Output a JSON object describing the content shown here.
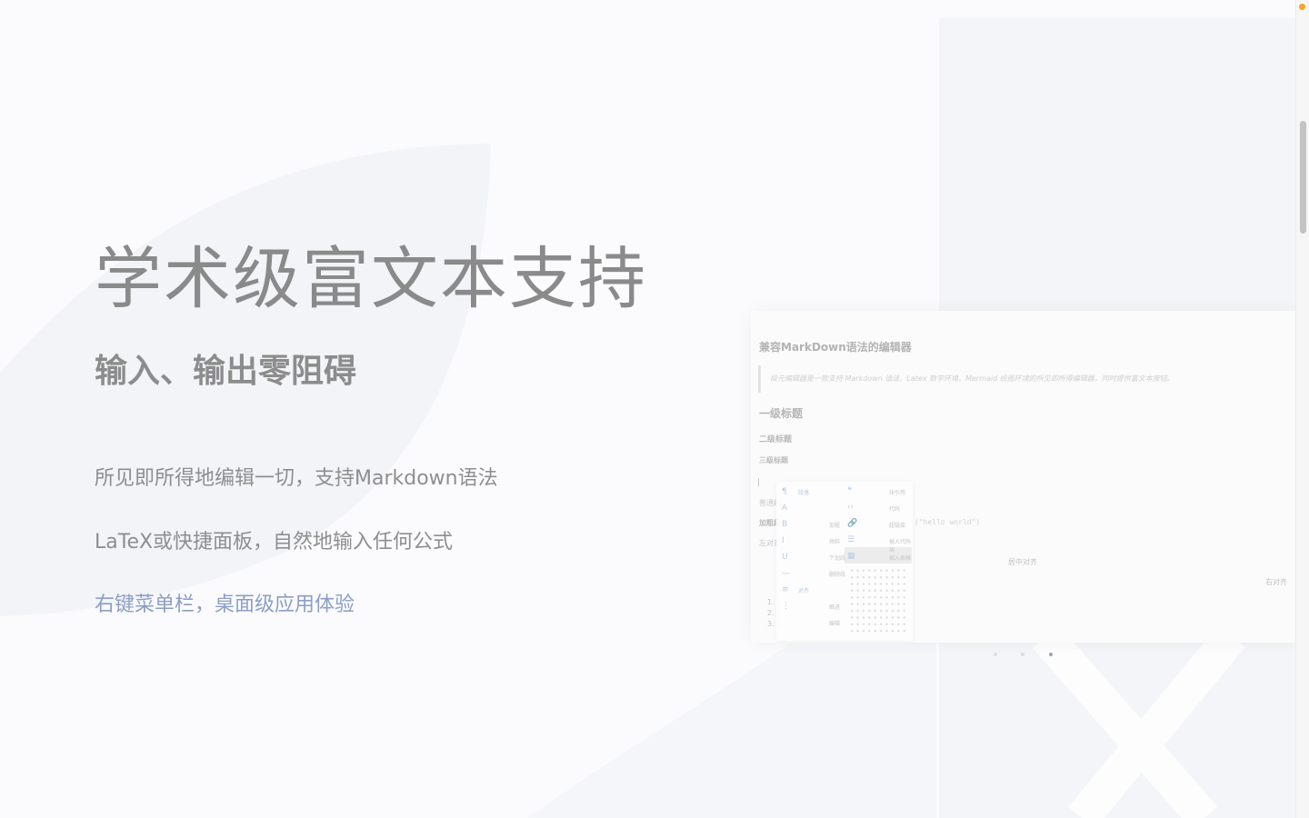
{
  "hero": {
    "title": "学术级富文本支持",
    "subtitle": "输入、输出零阻碍",
    "features": [
      "所见即所得地编辑一切，支持Markdown语法",
      "LaTeX或快捷面板，自然地输入任何公式",
      "右键菜单栏，桌面级应用体验"
    ]
  },
  "preview": {
    "doc_title": "兼容MarkDown语法的编辑器",
    "quote": "段元编辑器是一款支持 Markdown 语法、Latex 数学环境、Mermaid 绘图环境的所见即所得编辑器，同时提供富文本按钮。",
    "h1": "一级标题",
    "h2": "二级标题",
    "h3": "三级标题",
    "line1": "普通段",
    "line2": "加粗段",
    "line3": "左对齐",
    "center_text": "居中对齐",
    "right_text": "右对齐",
    "code_snippet": "(\"hello world\")",
    "list_text": "1. 1\n2. 1\n3. 1",
    "context_menu": {
      "rows": [
        {
          "icon": "¶",
          "left": "段落",
          "right_icon": "❝",
          "right": "块引用"
        },
        {
          "icon": "A",
          "left": "",
          "right_icon": "‹›",
          "right": "代码"
        },
        {
          "icon": "B",
          "left": "加粗",
          "right_icon": "🔗",
          "right": "超链接"
        },
        {
          "icon": "I",
          "left": "倾斜",
          "right_icon": "☰",
          "right": "插入代码块"
        },
        {
          "icon": "U",
          "left": "下划线",
          "right_icon": "▦",
          "right": "插入表格"
        },
        {
          "icon": "—",
          "left": "删除线",
          "right_icon": "",
          "right": ""
        },
        {
          "icon": "≡",
          "left": "对齐",
          "right_icon": "",
          "right": ""
        },
        {
          "icon": "⋮",
          "left": "缩进",
          "right_icon": "",
          "right": ""
        },
        {
          "icon": "",
          "left": "编辑",
          "right_icon": "",
          "right": ""
        }
      ]
    }
  },
  "carousel": {
    "count": 3,
    "active": 2
  },
  "colors": {
    "background": "#fbfbfd",
    "accent_link": "#8b9ec4",
    "notify": "#f5a623"
  }
}
